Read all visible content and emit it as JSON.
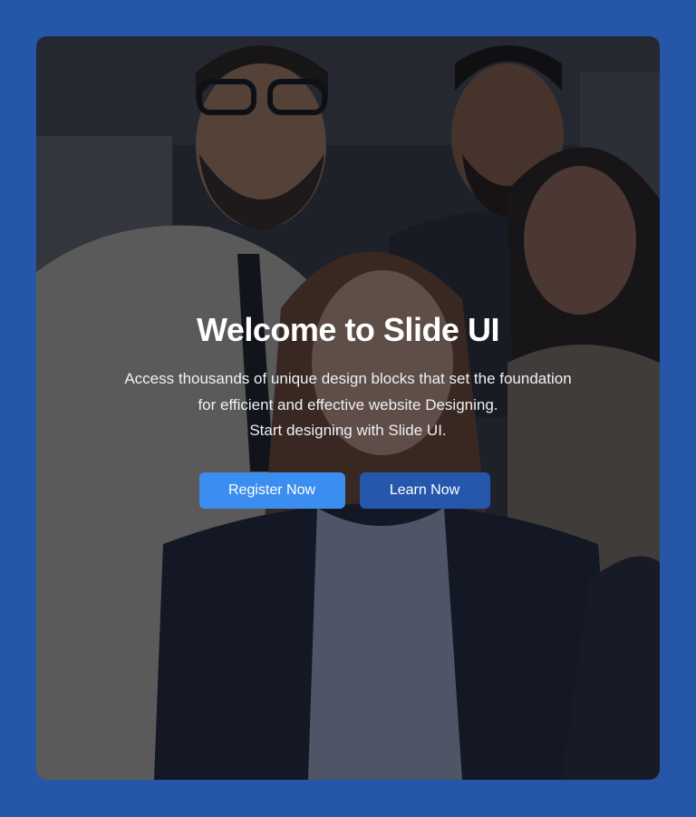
{
  "hero": {
    "title": "Welcome to Slide UI",
    "description_lines": [
      "Access thousands of unique design blocks that set the foundation",
      "for efficient and effective website Designing.",
      "Start designing with Slide UI."
    ],
    "buttons": {
      "register_label": "Register Now",
      "learn_label": "Learn Now"
    },
    "background_image": "team-group-photo"
  },
  "colors": {
    "page_background": "#2656a8",
    "primary_button": "#3b8ef0",
    "secondary_button": "#2557ad",
    "text": "#ffffff"
  }
}
